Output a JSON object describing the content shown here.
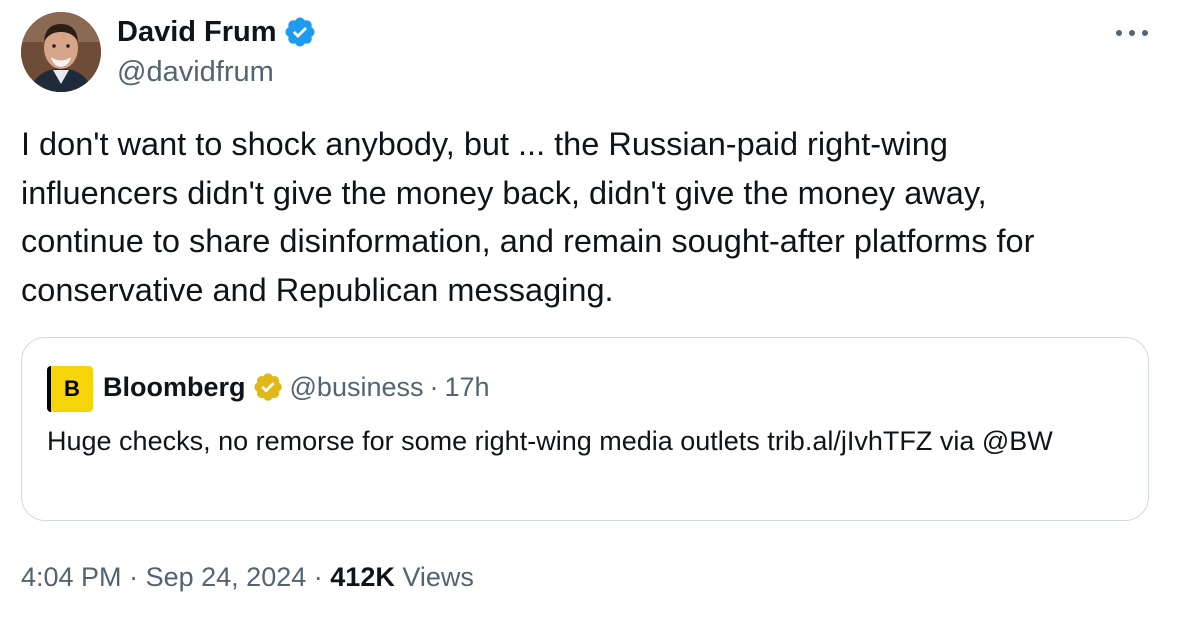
{
  "author": {
    "name": "David Frum",
    "handle": "@davidfrum",
    "verified_color": "#1d9bf0"
  },
  "more_icon": "more-horizontal-icon",
  "tweet": {
    "text": "I don't want to shock anybody, but ... the Russian-paid right-wing\ninfluencers didn't give the money back, didn't give the money away,\ncontinue to share disinformation, and remain sought-after platforms for\nconservative and Republican messaging."
  },
  "quote": {
    "avatar_letter": "B",
    "avatar_color": "#f5d50a",
    "name": "Bloomberg",
    "verified_color": "#e2b719",
    "handle": "@business",
    "separator": "·",
    "time": "17h",
    "text": "Huge checks, no remorse for some right-wing media outlets trib.al/jIvhTFZ via @BW"
  },
  "meta": {
    "time": "4:04 PM",
    "separator": "·",
    "date": "Sep 24, 2024",
    "views_count": "412K",
    "views_label": "Views"
  }
}
